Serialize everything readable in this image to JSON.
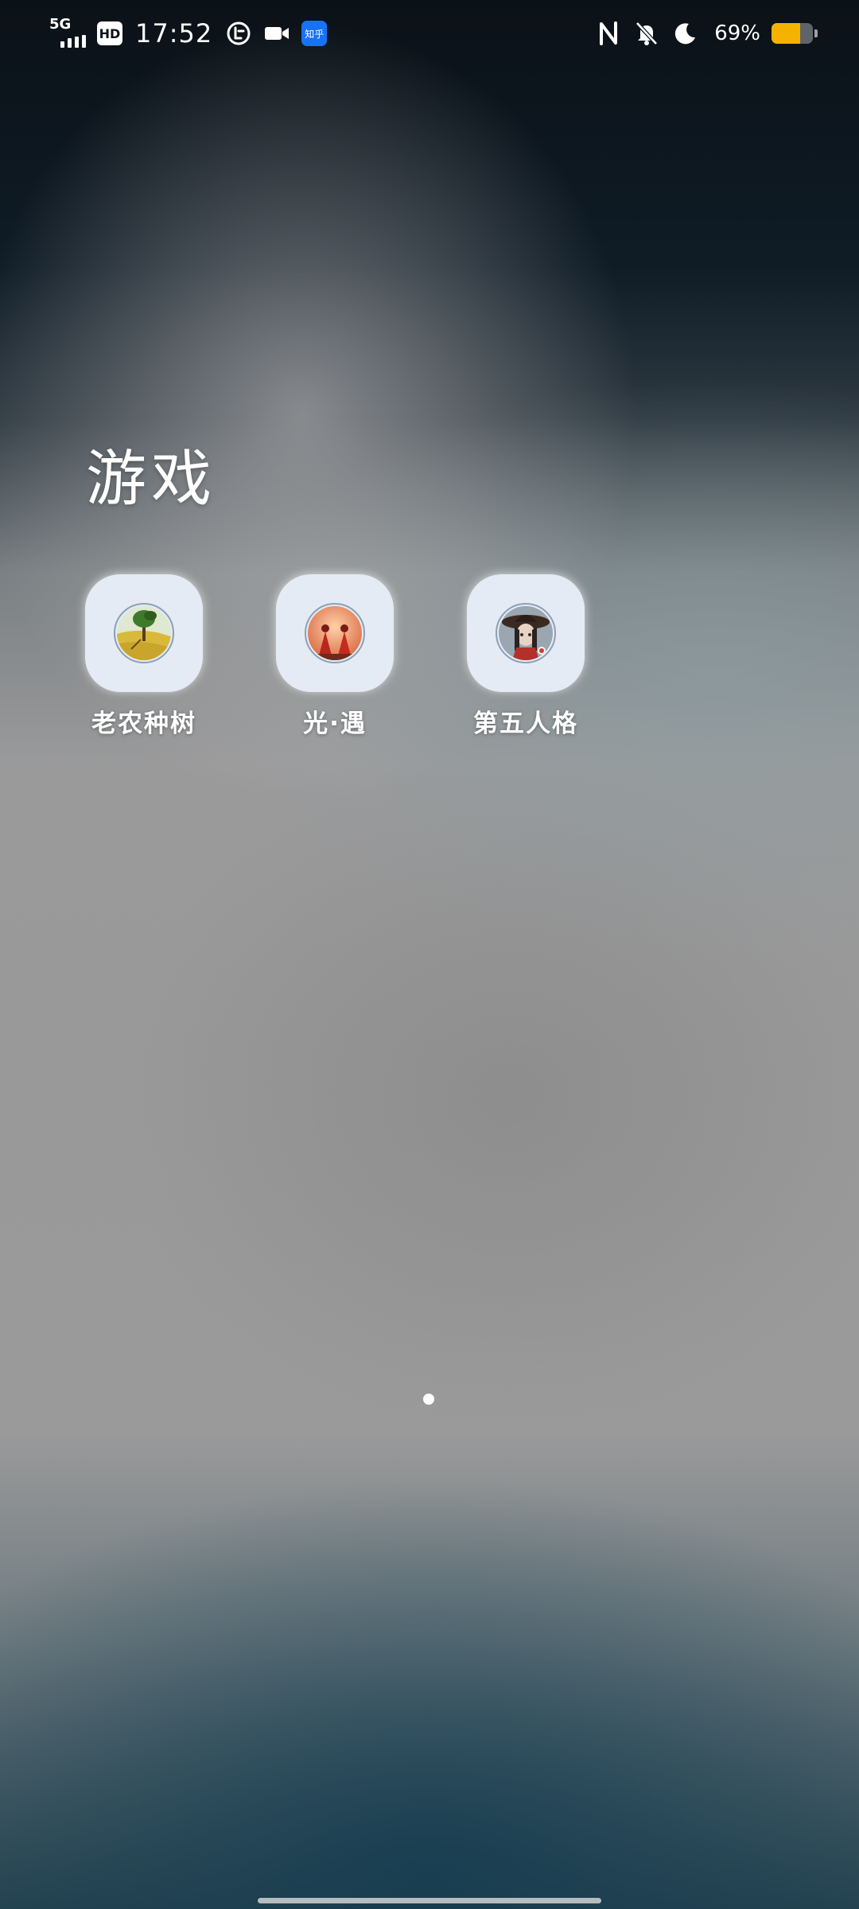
{
  "status_bar": {
    "network_type": "5G",
    "hd_label": "HD",
    "time": "17:52",
    "zhihu_label": "知乎",
    "battery_percent_text": "69%",
    "battery_level": 0.69,
    "icons": {
      "signal": "signal-bars-icon",
      "volte": "hd-badge-icon",
      "app_notify_1": "clock-badge-icon",
      "app_notify_2": "video-camera-icon",
      "app_notify_3": "zhihu-app-icon",
      "nfc": "nfc-icon",
      "silent": "bell-off-icon",
      "dnd": "moon-icon",
      "battery": "battery-icon"
    },
    "colors": {
      "battery_fill": "#f5b300",
      "zhihu_blue": "#1772f6"
    }
  },
  "folder": {
    "title": "游戏",
    "apps": [
      {
        "label": "老农种树",
        "icon": "farmer-tree-game-icon"
      },
      {
        "label": "光·遇",
        "icon": "sky-children-of-light-icon"
      },
      {
        "label": "第五人格",
        "icon": "identity-v-icon"
      }
    ]
  },
  "pager": {
    "pages": 1,
    "current": 1
  }
}
